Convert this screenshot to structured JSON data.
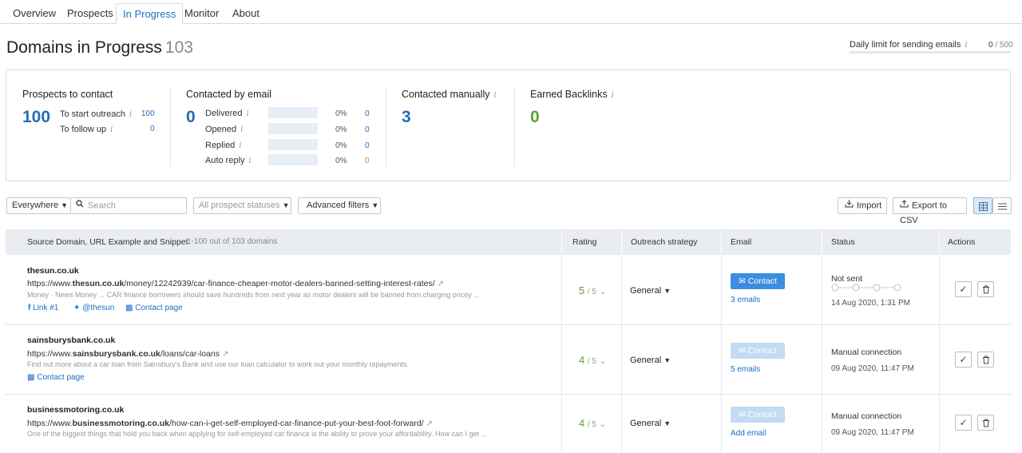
{
  "tabs": [
    {
      "label": "Overview"
    },
    {
      "label": "Prospects"
    },
    {
      "label": "In Progress"
    },
    {
      "label": "Monitor"
    },
    {
      "label": "About"
    }
  ],
  "page": {
    "title": "Domains in Progress",
    "count": "103",
    "daily_limit_label": "Daily limit for sending emails",
    "daily_limit_used": "0",
    "daily_limit_total": "/ 500",
    "daily_limit_fraction": 0
  },
  "summary": {
    "prospects": {
      "title": "Prospects to contact",
      "big": "100",
      "rows": [
        {
          "label": "To start outreach",
          "value": "100"
        },
        {
          "label": "To follow up",
          "value": "0"
        }
      ]
    },
    "contacted_email": {
      "title": "Contacted by email",
      "big": "0",
      "rows": [
        {
          "label": "Delivered",
          "pct": "0%",
          "value": "0"
        },
        {
          "label": "Opened",
          "pct": "0%",
          "value": "0"
        },
        {
          "label": "Replied",
          "pct": "0%",
          "value": "0"
        },
        {
          "label": "Auto reply",
          "pct": "0%",
          "value": "0"
        }
      ]
    },
    "contacted_manually": {
      "title": "Contacted manually",
      "big": "3"
    },
    "earned_backlinks": {
      "title": "Earned Backlinks",
      "big": "0"
    }
  },
  "filters": {
    "scope": "Everywhere",
    "search_placeholder": "Search",
    "status": "All prospect statuses",
    "advanced": "Advanced filters",
    "import": "Import",
    "export": "Export to CSV"
  },
  "table": {
    "headers": {
      "source": "Source Domain, URL Example and Snippet",
      "range": "1-100 out of 103 domains",
      "rating": "Rating",
      "strategy": "Outreach strategy",
      "email": "Email",
      "status": "Status",
      "actions": "Actions"
    },
    "rows": [
      {
        "domain": "thesun.co.uk",
        "url_prefix": "https://www.",
        "url_domain": "thesun.co.uk",
        "url_path": "/money/12242939/car-finance-cheaper-motor-dealers-banned-setting-interest-rates/",
        "snippet": "Money · News Money ... CAR finance borrowers should save hundreds from next year as motor dealers will be banned from charging pricey ...",
        "links": [
          "Link #1",
          "@thesun",
          "Contact page"
        ],
        "rating": "5",
        "rating_of": "/ 5",
        "strategy": "General",
        "contact_label": "Contact",
        "email_link": "3 emails",
        "status": "Not sent",
        "date": "14 Aug 2020, 1:31 PM"
      },
      {
        "domain": "sainsburysbank.co.uk",
        "url_prefix": "https://www.",
        "url_domain": "sainsburysbank.co.uk",
        "url_path": "/loans/car-loans",
        "snippet": "Find out more about a car loan from Sainsbury's Bank and use our loan calculator to work out your monthly repayments.",
        "links": [
          "Contact page"
        ],
        "rating": "4",
        "rating_of": "/ 5",
        "strategy": "General",
        "contact_label": "Contact",
        "email_link": "5 emails",
        "status": "Manual connection",
        "date": "09 Aug 2020, 11:47 PM"
      },
      {
        "domain": "businessmotoring.co.uk",
        "url_prefix": "https://www.",
        "url_domain": "businessmotoring.co.uk",
        "url_path": "/how-can-i-get-self-employed-car-finance-put-your-best-foot-forward/",
        "snippet": "One of the biggest things that hold you back when applying for self-employed car finance is the ability to prove your affordability. How can I get ...",
        "links": [],
        "rating": "4",
        "rating_of": "/ 5",
        "strategy": "General",
        "contact_label": "Contact",
        "email_link": "Add email",
        "status": "Manual connection",
        "date": "09 Aug 2020, 11:47 PM"
      }
    ]
  },
  "colors": {
    "accent": "#1a73c8",
    "green": "#5aa331",
    "orange": "#e38b2a"
  }
}
